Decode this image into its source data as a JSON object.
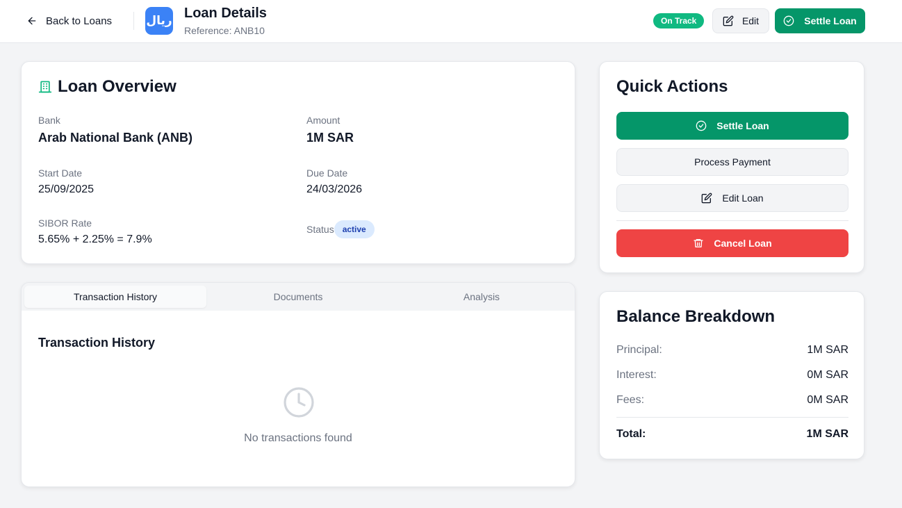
{
  "header": {
    "back_label": "Back to Loans",
    "logo_text": "ريال",
    "title": "Loan Details",
    "reference": "Reference: ANB10",
    "status_pill": "On Track",
    "edit_label": "Edit",
    "settle_label": "Settle Loan"
  },
  "overview": {
    "title": "Loan Overview",
    "fields": {
      "bank": {
        "label": "Bank",
        "value": "Arab National Bank (ANB)"
      },
      "amount": {
        "label": "Amount",
        "value": "1M SAR"
      },
      "start_date": {
        "label": "Start Date",
        "value": "25/09/2025"
      },
      "due_date": {
        "label": "Due Date",
        "value": "24/03/2026"
      },
      "sibor": {
        "label": "SIBOR Rate",
        "value": "5.65% + 2.25% = 7.9%"
      },
      "status": {
        "label": "Status",
        "value": "active"
      }
    }
  },
  "tabs": {
    "items": [
      {
        "label": "Transaction History",
        "active": true
      },
      {
        "label": "Documents",
        "active": false
      },
      {
        "label": "Analysis",
        "active": false
      }
    ],
    "section_title": "Transaction History",
    "empty_text": "No transactions found"
  },
  "quick_actions": {
    "title": "Quick Actions",
    "settle": "Settle Loan",
    "process_payment": "Process Payment",
    "edit_loan": "Edit Loan",
    "cancel_loan": "Cancel Loan"
  },
  "balance": {
    "title": "Balance Breakdown",
    "rows": [
      {
        "label": "Principal:",
        "value": "1M SAR"
      },
      {
        "label": "Interest:",
        "value": "0M SAR"
      },
      {
        "label": "Fees:",
        "value": "0M SAR"
      }
    ],
    "total": {
      "label": "Total:",
      "value": "1M SAR"
    }
  },
  "colors": {
    "brand_green": "#059669",
    "pill_green": "#10b981",
    "danger_red": "#ef4444",
    "logo_blue": "#3b82f6",
    "active_badge_bg": "#dbeafe",
    "active_badge_text": "#1e40af"
  },
  "icons": {
    "back": "arrow-left-icon",
    "edit": "edit-square-icon",
    "settle": "check-circle-icon",
    "overview": "building-icon",
    "empty": "clock-icon",
    "cancel": "trash-icon"
  }
}
